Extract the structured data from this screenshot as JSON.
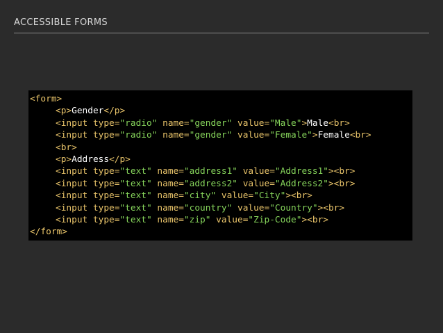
{
  "header": {
    "title": "ACCESSIBLE FORMS"
  },
  "colors": {
    "background": "#2b2b2b",
    "code_background": "#000000",
    "tag": "#e9c46a",
    "string": "#86d45b",
    "text": "#ffffff"
  },
  "code": {
    "lines": [
      {
        "tokens": [
          {
            "t": "tag",
            "v": "<form>"
          }
        ]
      },
      {
        "tokens": [
          {
            "t": "tag",
            "v": "<p>"
          },
          {
            "t": "txt",
            "v": "Gender"
          },
          {
            "t": "tag",
            "v": "</p>"
          }
        ]
      },
      {
        "tokens": [
          {
            "t": "tag",
            "v": "<input "
          },
          {
            "t": "attr",
            "v": "type="
          },
          {
            "t": "str",
            "v": "\"radio\""
          },
          {
            "t": "attr",
            "v": " name="
          },
          {
            "t": "str",
            "v": "\"gender\""
          },
          {
            "t": "attr",
            "v": " value="
          },
          {
            "t": "str",
            "v": "\"Male\""
          },
          {
            "t": "tag",
            "v": ">"
          },
          {
            "t": "txt",
            "v": "Male"
          },
          {
            "t": "tag",
            "v": "<br>"
          }
        ]
      },
      {
        "tokens": [
          {
            "t": "tag",
            "v": "<input "
          },
          {
            "t": "attr",
            "v": "type="
          },
          {
            "t": "str",
            "v": "\"radio\""
          },
          {
            "t": "attr",
            "v": " name="
          },
          {
            "t": "str",
            "v": "\"gender\""
          },
          {
            "t": "attr",
            "v": " value="
          },
          {
            "t": "str",
            "v": "\"Female\""
          },
          {
            "t": "tag",
            "v": ">"
          },
          {
            "t": "txt",
            "v": "Female"
          },
          {
            "t": "tag",
            "v": "<br>"
          }
        ]
      },
      {
        "tokens": [
          {
            "t": "tag",
            "v": "<br>"
          }
        ]
      },
      {
        "tokens": [
          {
            "t": "tag",
            "v": "<p>"
          },
          {
            "t": "txt",
            "v": "Address"
          },
          {
            "t": "tag",
            "v": "</p>"
          }
        ]
      },
      {
        "tokens": [
          {
            "t": "tag",
            "v": "<input "
          },
          {
            "t": "attr",
            "v": "type="
          },
          {
            "t": "str",
            "v": "\"text\""
          },
          {
            "t": "attr",
            "v": " name="
          },
          {
            "t": "str",
            "v": "\"address1\""
          },
          {
            "t": "attr",
            "v": " value="
          },
          {
            "t": "str",
            "v": "\"Address1\""
          },
          {
            "t": "tag",
            "v": "><br>"
          }
        ]
      },
      {
        "tokens": [
          {
            "t": "tag",
            "v": "<input "
          },
          {
            "t": "attr",
            "v": "type="
          },
          {
            "t": "str",
            "v": "\"text\""
          },
          {
            "t": "attr",
            "v": " name="
          },
          {
            "t": "str",
            "v": "\"address2\""
          },
          {
            "t": "attr",
            "v": " value="
          },
          {
            "t": "str",
            "v": "\"Address2\""
          },
          {
            "t": "tag",
            "v": "><br>"
          }
        ]
      },
      {
        "tokens": [
          {
            "t": "tag",
            "v": "<input "
          },
          {
            "t": "attr",
            "v": "type="
          },
          {
            "t": "str",
            "v": "\"text\""
          },
          {
            "t": "attr",
            "v": " name="
          },
          {
            "t": "str",
            "v": "\"city\""
          },
          {
            "t": "attr",
            "v": " value="
          },
          {
            "t": "str",
            "v": "\"City\""
          },
          {
            "t": "tag",
            "v": "><br>"
          }
        ]
      },
      {
        "tokens": [
          {
            "t": "tag",
            "v": "<input "
          },
          {
            "t": "attr",
            "v": "type="
          },
          {
            "t": "str",
            "v": "\"text\""
          },
          {
            "t": "attr",
            "v": " name="
          },
          {
            "t": "str",
            "v": "\"country\""
          },
          {
            "t": "attr",
            "v": " value="
          },
          {
            "t": "str",
            "v": "\"Country\""
          },
          {
            "t": "tag",
            "v": "><br>"
          }
        ]
      },
      {
        "tokens": [
          {
            "t": "tag",
            "v": "<input "
          },
          {
            "t": "attr",
            "v": "type="
          },
          {
            "t": "str",
            "v": "\"text\""
          },
          {
            "t": "attr",
            "v": " name="
          },
          {
            "t": "str",
            "v": "\"zip\""
          },
          {
            "t": "attr",
            "v": " value="
          },
          {
            "t": "str",
            "v": "\"Zip-Code\""
          },
          {
            "t": "tag",
            "v": "><br>"
          }
        ]
      },
      {
        "tokens": [
          {
            "t": "tag",
            "v": "</form>"
          }
        ]
      }
    ]
  }
}
